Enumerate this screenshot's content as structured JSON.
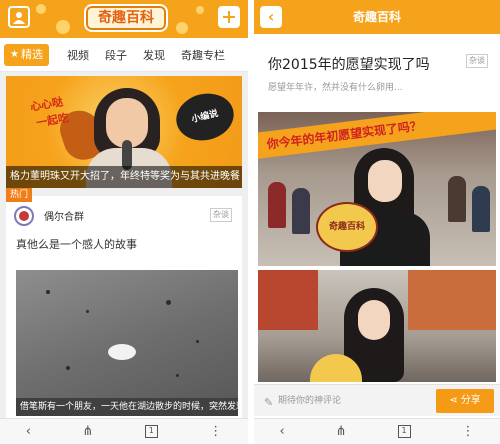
{
  "left": {
    "header": {
      "logo_text": "奇趣百科"
    },
    "tabs": [
      {
        "label": "精选"
      },
      {
        "label": "视频"
      },
      {
        "label": "段子"
      },
      {
        "label": "发现"
      },
      {
        "label": "奇趣专栏"
      }
    ],
    "feature": {
      "overlay_line1": "心心哒",
      "overlay_line2": "一起吃",
      "badge_text": "小编说",
      "caption": "格力董明珠又开大招了，年终特等奖为与其共进晚餐"
    },
    "hot_tag": "热门",
    "post": {
      "username": "偶尔合群",
      "category": "杂谈",
      "title": "真他么是一个感人的故事",
      "image_caption": "借笔斯有一个朋友，一天他在湖边散步的时候，突然发现一只"
    },
    "bottom_bar": {
      "tab_count": "1"
    }
  },
  "right": {
    "header": {
      "title": "奇趣百科"
    },
    "article": {
      "title": "你2015年的愿望实现了吗",
      "subtitle": "愿望年年许，然并没有什么卵用...",
      "category": "杂谈",
      "banner_text": "你今年的年初愿望实现了吗？",
      "sign_text": "奇趣百科"
    },
    "comment": {
      "placeholder": "期待你的神评论",
      "share_label": "分享"
    },
    "bottom_bar": {
      "tab_count": "1"
    }
  }
}
